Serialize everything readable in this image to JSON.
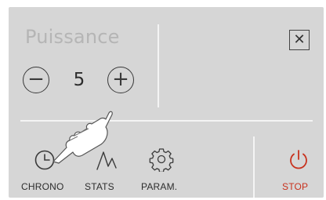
{
  "power": {
    "title": "Puissance",
    "value": "5",
    "minus_symbol": "−",
    "plus_symbol": "+"
  },
  "close_symbol": "✕",
  "nav": {
    "chrono": "CHRONO",
    "stats": "STATS",
    "params": "PARAM.",
    "stop": "STOP"
  },
  "colors": {
    "panel": "#d6d6d6",
    "stop": "#c8321e"
  },
  "icons": [
    "minus-icon",
    "plus-icon",
    "close-icon",
    "clock-icon",
    "chart-icon",
    "gear-icon",
    "power-icon",
    "hand-pointer-icon"
  ]
}
